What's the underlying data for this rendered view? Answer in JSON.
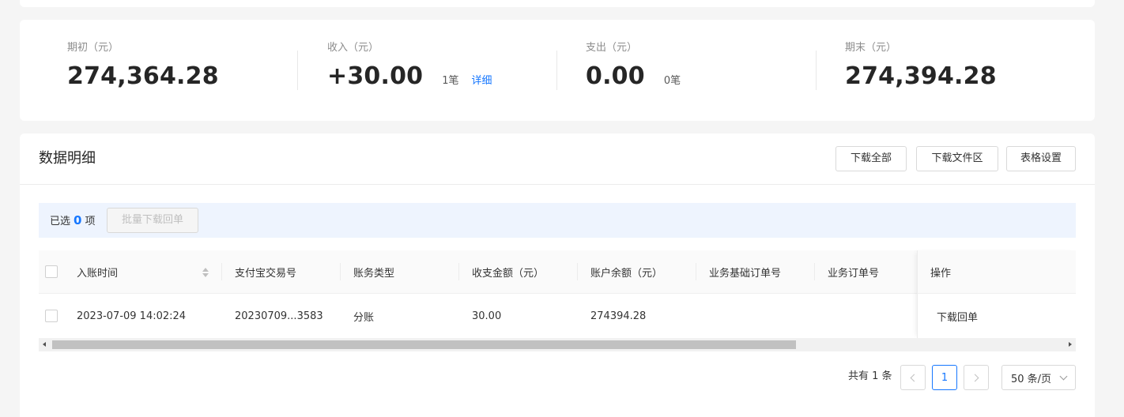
{
  "summary": {
    "opening": {
      "label": "期初（元）",
      "value": "274,364.28"
    },
    "income": {
      "label": "收入（元）",
      "value": "+30.00",
      "count": "1笔",
      "detail_link": "详细"
    },
    "expense": {
      "label": "支出（元）",
      "value": "0.00",
      "count": "0笔"
    },
    "closing": {
      "label": "期末（元）",
      "value": "274,394.28"
    }
  },
  "detail": {
    "title": "数据明细",
    "buttons": {
      "download_all": "下载全部",
      "download_area": "下载文件区",
      "table_settings": "表格设置"
    }
  },
  "selection": {
    "prefix": "已选",
    "count": "0",
    "suffix": "项",
    "batch_button": "批量下载回单"
  },
  "table": {
    "columns": [
      "入账时间",
      "支付宝交易号",
      "账务类型",
      "收支金额（元）",
      "账户余额（元）",
      "业务基础订单号",
      "业务订单号",
      "操作"
    ],
    "rows": [
      {
        "time": "2023-07-09 14:02:24",
        "trade_no": "20230709...3583",
        "type": "分账",
        "amount": "30.00",
        "balance": "274394.28",
        "base_order": "",
        "order": "",
        "action": "下载回单"
      }
    ]
  },
  "pagination": {
    "total": "共有 1 条",
    "current_page": "1",
    "page_size": "50 条/页"
  },
  "colors": {
    "accent": "#1677ff",
    "selection_bg": "#eef4fe"
  }
}
